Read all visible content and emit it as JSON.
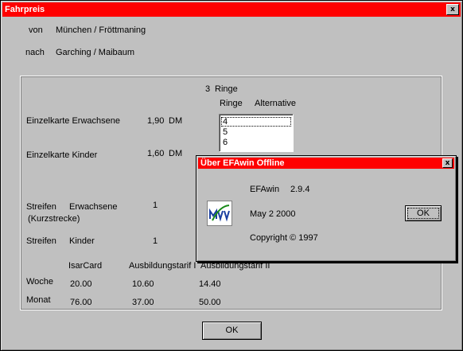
{
  "window": {
    "title": "Fahrpreis",
    "close_glyph": "x"
  },
  "route": {
    "from_label": "von",
    "from_value": "München / Fröttmaning",
    "to_label": "nach",
    "to_value": "Garching / Maibaum"
  },
  "rings": {
    "count": "3",
    "count_label": "Ringe",
    "col_rings": "Ringe",
    "col_alternative": "Alternative"
  },
  "alternatives": {
    "options": [
      "4",
      "5",
      "6"
    ],
    "selected": "4"
  },
  "fares": {
    "single_adult": {
      "label": "Einzelkarte Erwachsene",
      "price": "1,90",
      "currency": "DM"
    },
    "single_child": {
      "label": "Einzelkarte Kinder",
      "price": "1,60",
      "currency": "DM"
    },
    "strip_adult": {
      "label1": "Streifen",
      "label2": "Erwachsene",
      "note": "(Kurzstrecke)",
      "count": "1"
    },
    "strip_child": {
      "label1": "Streifen",
      "label2": "Kinder",
      "count": "1"
    }
  },
  "table": {
    "columns": [
      "IsarCard",
      "Ausbildungstarif I",
      "Ausbildungstarif II"
    ],
    "rows": [
      {
        "label": "Woche",
        "values": [
          "20.00",
          "10.60",
          "14.40"
        ]
      },
      {
        "label": "Monat",
        "values": [
          "76.00",
          "37.00",
          "50.00"
        ]
      }
    ]
  },
  "ok_label": "OK",
  "about": {
    "title": "Über EFAwin Offline",
    "close_glyph": "x",
    "app_name": "EFAwin",
    "version": "2.9.4",
    "date": "May  2 2000",
    "copyright": "Copyright © 1997",
    "ok_label": "OK",
    "logo_icon": "mvv-logo-icon"
  }
}
